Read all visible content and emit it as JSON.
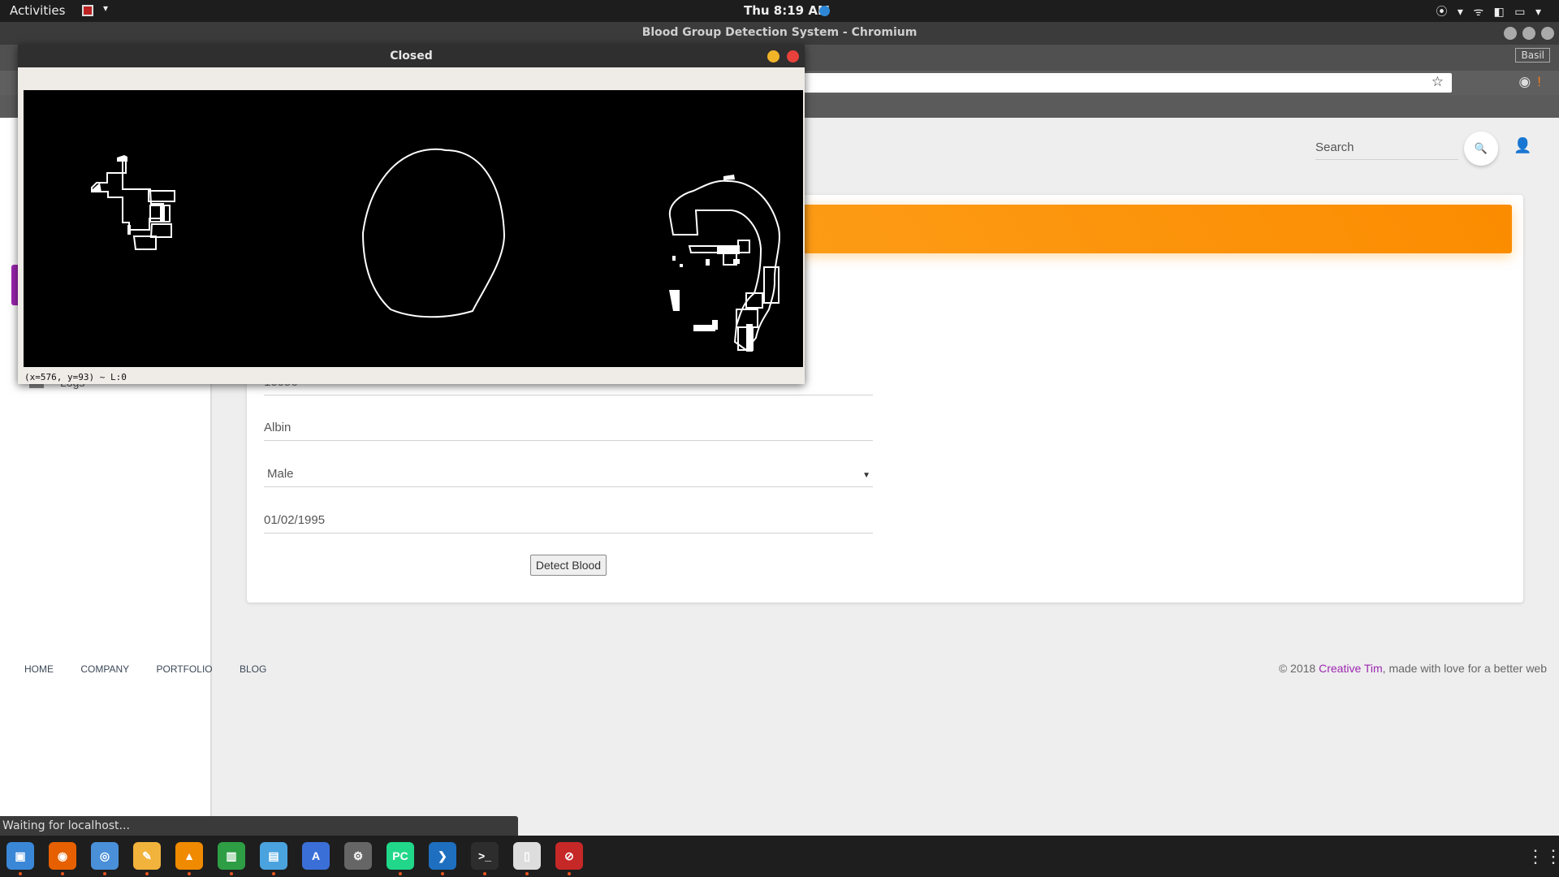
{
  "topbar": {
    "activities": "Activities",
    "app_caret": "▾",
    "clock": "Thu  8:19 AM",
    "tray_icons": "⦿ ▾   ᯤ ◧ ▭ ▾"
  },
  "browser": {
    "window_title": "Blood Group Detection System - Chromium",
    "profile": "Basil",
    "status_text": "Waiting for localhost...",
    "star_icon": "☆",
    "extension_icons": [
      "◉"
    ],
    "extension_orange": "!"
  },
  "page": {
    "search_label": "Search",
    "search_icon": "🔍",
    "user_icon": "👤",
    "logs_label": "Logs",
    "form": {
      "id_value": "10096",
      "name_value": "Albin",
      "gender_value": "Male",
      "gender_caret": "▼",
      "dob_value": "01/02/1995",
      "detect_button": "Detect Blood"
    },
    "footer": {
      "nav": [
        "HOME",
        "COMPANY",
        "PORTFOLIO",
        "BLOG"
      ],
      "copyright_prefix": "© 2018 ",
      "copyright_link": "Creative Tim",
      "copyright_suffix": ", made with love for a better web"
    }
  },
  "cv_window": {
    "title": "Closed",
    "status": "(x=576, y=93) ~ L:0"
  },
  "dock": {
    "apps": [
      {
        "name": "files",
        "color": "#3a87d8",
        "glyph": "▣"
      },
      {
        "name": "firefox",
        "color": "#e66000",
        "glyph": "◉"
      },
      {
        "name": "chromium",
        "color": "#4a90d9",
        "glyph": "◎"
      },
      {
        "name": "text-editor",
        "color": "#f2b33d",
        "glyph": "✎"
      },
      {
        "name": "vlc",
        "color": "#f08a00",
        "glyph": "▲"
      },
      {
        "name": "calc",
        "color": "#2e9e45",
        "glyph": "▥"
      },
      {
        "name": "impress",
        "color": "#4aa3df",
        "glyph": "▤"
      },
      {
        "name": "software",
        "color": "#3b6fd8",
        "glyph": "A"
      },
      {
        "name": "settings",
        "color": "#666666",
        "glyph": "⚙"
      },
      {
        "name": "pycharm",
        "color": "#21d789",
        "glyph": "PC"
      },
      {
        "name": "vscode",
        "color": "#1e6fc0",
        "glyph": "❯"
      },
      {
        "name": "terminal",
        "color": "#2d2d2d",
        "glyph": ">_"
      },
      {
        "name": "notes",
        "color": "#dddddd",
        "glyph": "▯"
      },
      {
        "name": "opencv-app",
        "color": "#c62828",
        "glyph": "⊘"
      }
    ],
    "grid_icon": "⋮⋮⋮"
  },
  "colors": {
    "accent_purple": "#9c27b0",
    "header_orange": "#fb8c00"
  }
}
